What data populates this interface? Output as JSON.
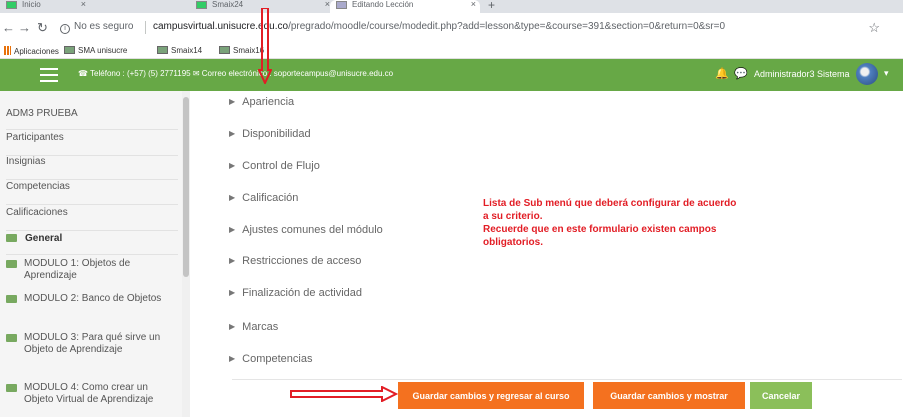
{
  "browser": {
    "tabs": [
      {
        "label": "Inicio",
        "active": false
      },
      {
        "label": "Smaix24",
        "active": false
      },
      {
        "label": "Editando Lección",
        "active": true
      }
    ],
    "secure_label": "No es seguro",
    "url_host": "campusvirtual.unisucre.edu.co",
    "url_path": "/pregrado/moodle/course/modedit.php?add=lesson&type=&course=391&section=0&return=0&sr=0",
    "bookmarks": [
      {
        "label": "Aplicaciones",
        "icon": "apps-icon"
      },
      {
        "label": "SMA unisucre",
        "icon": "bookmark-icon"
      },
      {
        "label": "Smaix14",
        "icon": "bookmark-icon"
      },
      {
        "label": "Smaix16",
        "icon": "bookmark-icon"
      }
    ]
  },
  "navbar": {
    "contact": "☎ Teléfono : (+57) (5) 2771195  ✉ Correo electrónico : soportecampus@unisucre.edu.co",
    "user_name": "Administrador3 Sistema",
    "bg_color": "#67a846"
  },
  "sidebar": {
    "items": [
      {
        "label": "ADM3 PRUEBA"
      },
      {
        "label": "Participantes"
      },
      {
        "label": "Insignias"
      },
      {
        "label": "Competencias"
      },
      {
        "label": "Calificaciones"
      },
      {
        "label": "General"
      }
    ],
    "modules": [
      {
        "label": "MODULO 1: Objetos de Aprendizaje"
      },
      {
        "label": "MODULO 2: Banco de Objetos"
      },
      {
        "label": "MODULO 3: Para qué sirve un Objeto de Aprendizaje"
      },
      {
        "label": "MODULO 4: Como crear un Objeto Virtual de Aprendizaje"
      }
    ]
  },
  "sections": [
    {
      "label": "Apariencia"
    },
    {
      "label": "Disponibilidad"
    },
    {
      "label": "Control de Flujo"
    },
    {
      "label": "Calificación"
    },
    {
      "label": "Ajustes comunes del módulo"
    },
    {
      "label": "Restricciones de acceso"
    },
    {
      "label": "Finalización de actividad"
    },
    {
      "label": "Marcas"
    },
    {
      "label": "Competencias"
    }
  ],
  "annotation": {
    "line1": "Lista de Sub menú que deberá configurar de acuerdo",
    "line2": "a su criterio.",
    "line3": "Recuerde que en este formulario existen campos",
    "line4": "obligatorios.",
    "color": "#e21d25"
  },
  "buttons": {
    "save_return": "Guardar cambios y regresar al curso",
    "save_show": "Guardar cambios y mostrar",
    "cancel": "Cancelar",
    "primary_color": "#f4711f",
    "cancel_color": "#8bbf5a"
  }
}
